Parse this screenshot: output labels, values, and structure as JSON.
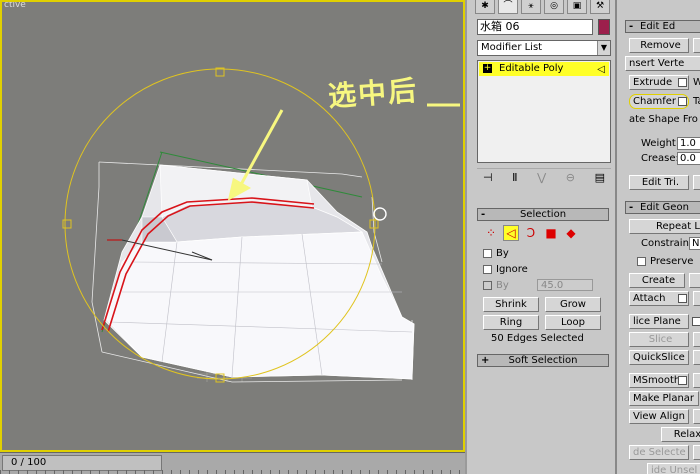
{
  "viewport": {
    "label": "ctive",
    "annotation_text": "选中后"
  },
  "timeline": {
    "frame": "0 / 100"
  },
  "command_panel": {
    "object_name": "水箱   06",
    "object_color": "#9c1f4c",
    "modifier_list_label": "Modifier List",
    "stack_item": "Editable Poly",
    "selection": {
      "title": "Selection",
      "by_vertex": "By",
      "ignore": "Ignore",
      "by_angle": "By",
      "angle_value": "45.0",
      "shrink": "Shrink",
      "grow": "Grow",
      "ring": "Ring",
      "loop": "Loop",
      "status": "50 Edges Selected"
    },
    "soft_selection": "Soft Selection"
  },
  "edit_edges": {
    "title": "Edit Ed",
    "remove": "Remove",
    "insert_vertex": "nsert Verte",
    "extrude": "Extrude",
    "chamfer": "Chamfer",
    "create_shape": "ate Shape Fro",
    "weight_label": "Weight:",
    "weight_value": "1.0",
    "crease_label": "Crease:",
    "crease_value": "0.0",
    "edit_tri": "Edit Tri."
  },
  "edit_geometry": {
    "title": "Edit Geon",
    "repeat": "Repeat L",
    "constraints_label": "Constraints:",
    "constraints_value": "No",
    "preserve": "Preserve",
    "create": "Create",
    "attach": "Attach",
    "slice_plane": "lice Plane",
    "slice": "Slice",
    "quickslice": "QuickSlice",
    "msmooth": "MSmooth",
    "make_planar": "Make Planar",
    "view_align": "View Align",
    "relax": "Relax",
    "hide_selected": "de Selecte",
    "hide_unselected": "ide Unsel"
  }
}
